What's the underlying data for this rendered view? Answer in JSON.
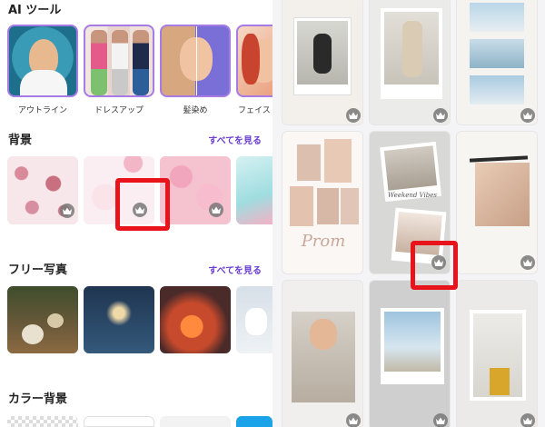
{
  "ai_tools": {
    "title": "AI ツール",
    "items": [
      {
        "label": "アウトライン"
      },
      {
        "label": "ドレスアップ"
      },
      {
        "label": "髪染め"
      },
      {
        "label": "フェイス"
      }
    ]
  },
  "backgrounds": {
    "title": "背景",
    "see_all": "すべてを見る"
  },
  "free_photos": {
    "title": "フリー写真",
    "see_all": "すべてを見る"
  },
  "color_backgrounds": {
    "title": "カラー背景"
  },
  "templates": {
    "prom_text": "Prom",
    "weekend_text": "Weekend Vibes"
  },
  "icons": {
    "premium": "crown-icon"
  },
  "colors": {
    "accent": "#6a3fd0",
    "highlight": "#e8131b",
    "card_border": "#a67be6"
  }
}
